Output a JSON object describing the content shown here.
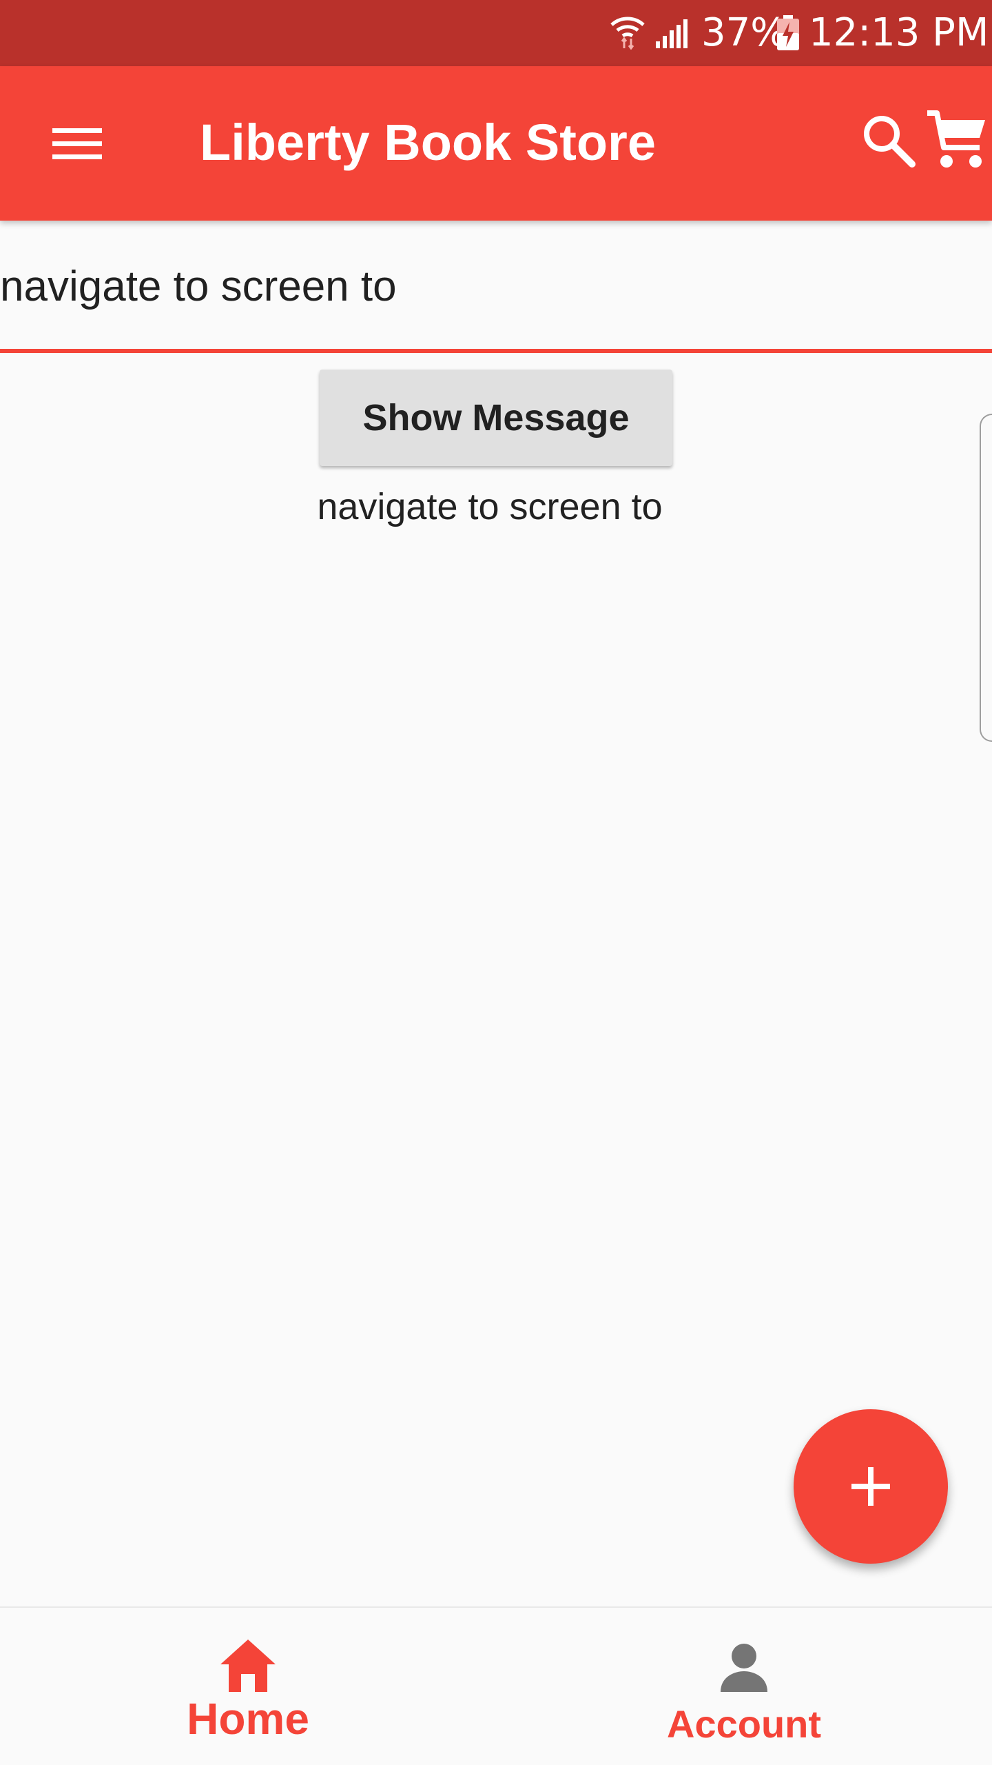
{
  "status_bar": {
    "battery_percent": "37%",
    "time": "12:13 PM",
    "icons": [
      "wifi-icon",
      "signal-icon",
      "battery-charging-icon"
    ]
  },
  "app_bar": {
    "title": "Liberty Book Store",
    "icons": [
      "menu-icon",
      "search-icon",
      "cart-icon"
    ],
    "color": "#f44438"
  },
  "text_field": {
    "value": "navigate to screen to"
  },
  "button": {
    "label": "Show Message"
  },
  "message": {
    "text": "navigate to screen to"
  },
  "fab": {
    "icon": "plus-icon"
  },
  "bottom_nav": {
    "items": [
      {
        "label": "Home",
        "icon": "home-icon"
      },
      {
        "label": "Account",
        "icon": "account-icon"
      }
    ]
  },
  "colors": {
    "primary": "#f44438",
    "status_bar": "#b9312b",
    "background": "#fafafa",
    "button": "#e0e0e0"
  }
}
